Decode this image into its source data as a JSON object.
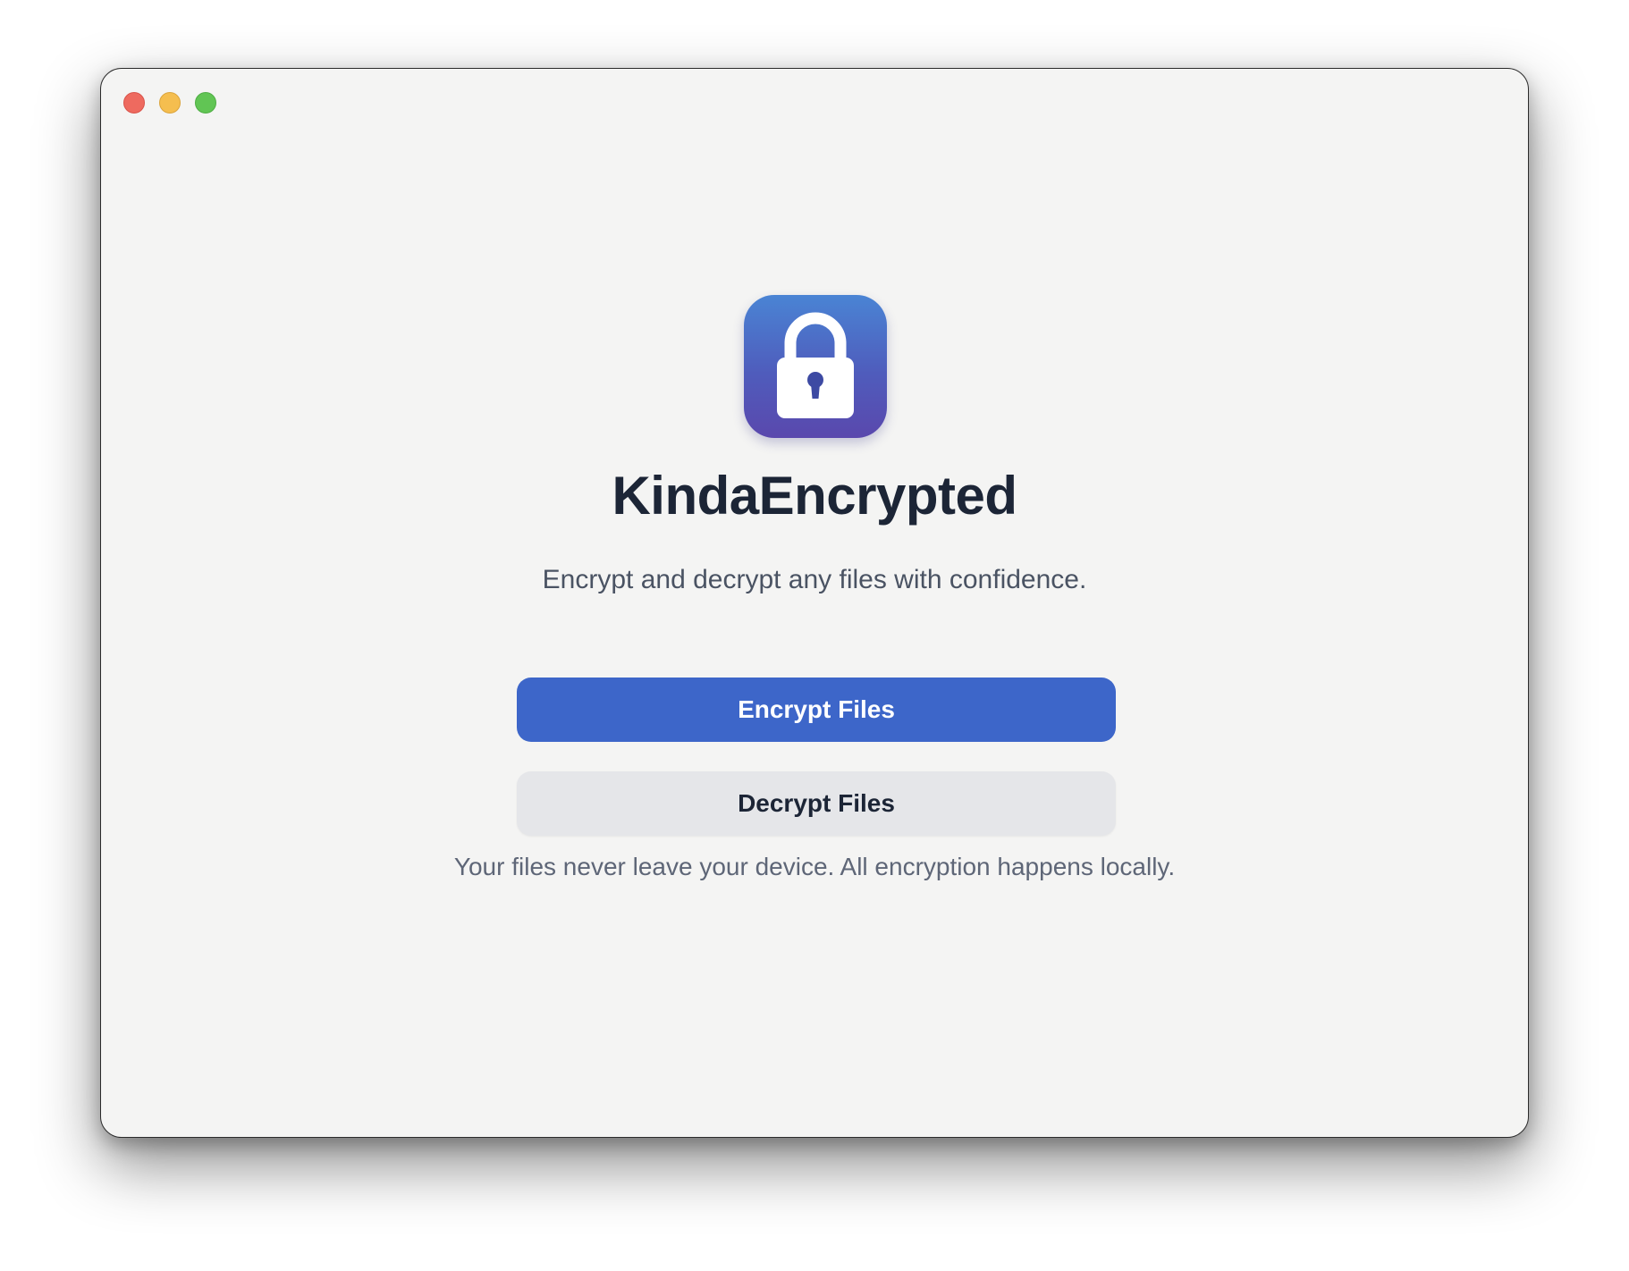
{
  "window": {
    "controls": {
      "close": "close",
      "minimize": "minimize",
      "zoom": "zoom"
    }
  },
  "app": {
    "icon": "lock-icon",
    "name": "KindaEncrypted",
    "tagline": "Encrypt and decrypt any files with confidence."
  },
  "actions": {
    "encrypt_label": "Encrypt Files",
    "decrypt_label": "Decrypt Files"
  },
  "footer": {
    "note": "Your files never leave your device. All encryption happens locally."
  },
  "colors": {
    "primary": "#3d66c9",
    "secondary": "#e5e6e9",
    "title": "#1c2536",
    "window_bg": "#f4f4f3",
    "traffic_red": "#ee6a5f",
    "traffic_yellow": "#f5be4f",
    "traffic_green": "#61c554"
  }
}
